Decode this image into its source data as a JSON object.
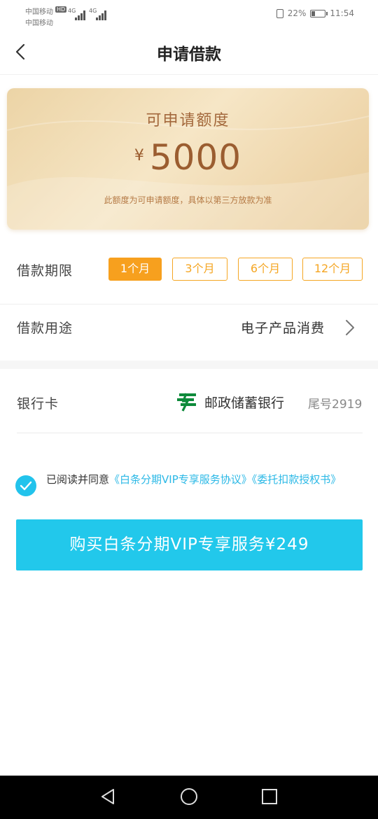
{
  "status_bar": {
    "carrier1": "中国移动",
    "carrier2": "中国移动",
    "hd": "HD",
    "net1": "4G",
    "net2": "4G",
    "battery_pct": "22%",
    "time": "11:54"
  },
  "header": {
    "title": "申请借款"
  },
  "credit": {
    "label": "可申请额度",
    "currency": "¥",
    "amount": "5000",
    "note": "此额度为可申请额度，具体以第三方放款为准"
  },
  "term": {
    "label": "借款期限",
    "options": [
      "1个月",
      "3个月",
      "6个月",
      "12个月"
    ],
    "selected_index": 0
  },
  "purpose": {
    "label": "借款用途",
    "value": "电子产品消费"
  },
  "bank": {
    "label": "银行卡",
    "name": "邮政储蓄银行",
    "tail": "尾号2919"
  },
  "agreement": {
    "prefix": "已阅读并同意",
    "link1": "《白条分期VIP专享服务协议》",
    "link2": "《委托扣款授权书》",
    "checked": true
  },
  "buy_button": {
    "label": "购买白条分期VIP专享服务¥249"
  },
  "colors": {
    "accent_orange": "#f7a01e",
    "accent_blue": "#22c8eb",
    "amount_brown": "#9b5d30"
  }
}
